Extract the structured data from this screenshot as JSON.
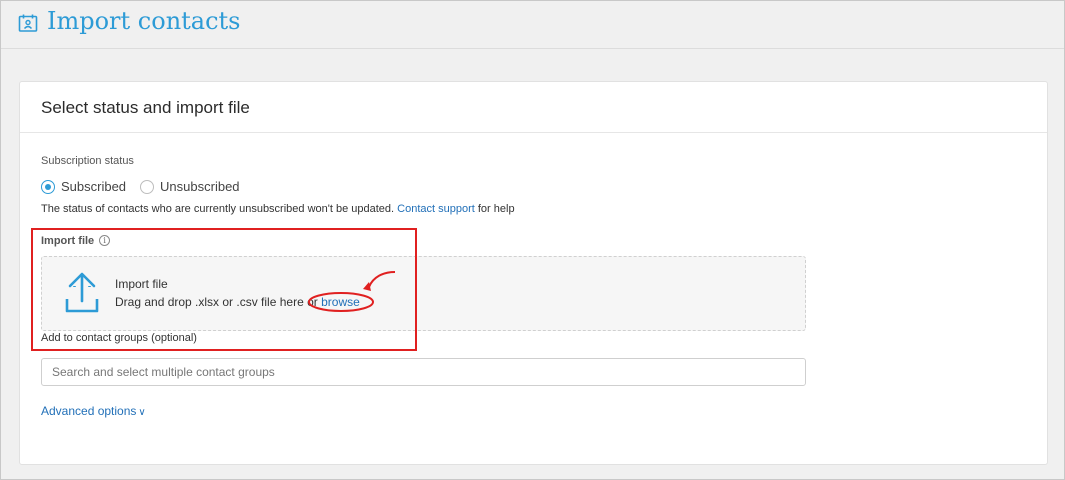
{
  "header": {
    "title": "Import contacts",
    "icon": "contact-calendar-icon"
  },
  "card": {
    "title": "Select status and import file",
    "subscription": {
      "label": "Subscription status",
      "options": [
        "Subscribed",
        "Unsubscribed"
      ],
      "selected": "Subscribed",
      "help_prefix": "The status of contacts who are currently unsubscribed won't be updated.",
      "help_link": "Contact support",
      "help_suffix": "for help"
    },
    "import_file": {
      "label": "Import file",
      "info_glyph": "i",
      "drop_title": "Import file",
      "drop_desc": "Drag and drop .xlsx or .csv file here or",
      "browse": "browse"
    },
    "groups": {
      "label": "Add to contact groups (optional)",
      "placeholder": "Search and select multiple contact groups"
    },
    "advanced_label": "Advanced options",
    "advanced_chevron": "∨"
  },
  "colors": {
    "accent": "#2d9bd6",
    "link": "#2270b8",
    "annotation": "#e02020"
  }
}
